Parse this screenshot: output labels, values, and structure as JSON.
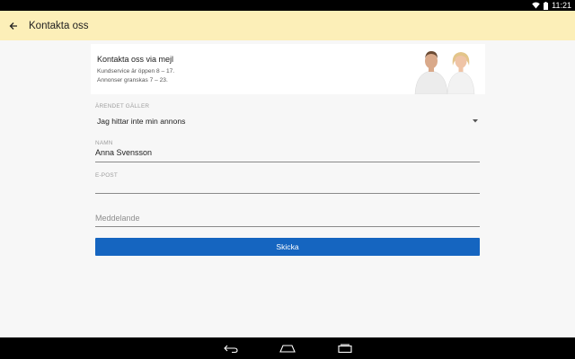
{
  "status_bar": {
    "time": "11:21",
    "icons": [
      "wifi-icon",
      "battery-icon"
    ]
  },
  "app_bar": {
    "title": "Kontakta oss",
    "back_icon": "arrow-back-icon"
  },
  "banner": {
    "title": "Kontakta oss via mejl",
    "line1": "Kundservice är öppen 8 – 17.",
    "line2": "Annonser granskas 7 – 23."
  },
  "form": {
    "subject": {
      "label": "ÄRENDET GÄLLER",
      "value": "Jag hittar inte min annons"
    },
    "name": {
      "label": "NAMN",
      "value": "Anna Svensson"
    },
    "email": {
      "label": "E-POST",
      "value": ""
    },
    "message": {
      "placeholder": "Meddelande"
    },
    "submit_label": "Skicka"
  },
  "nav_bar": {
    "icons": [
      "back-icon",
      "home-icon",
      "recents-icon"
    ]
  },
  "colors": {
    "app_bar": "#fcefb8",
    "button": "#1565c0",
    "background": "#f7f7f7"
  }
}
